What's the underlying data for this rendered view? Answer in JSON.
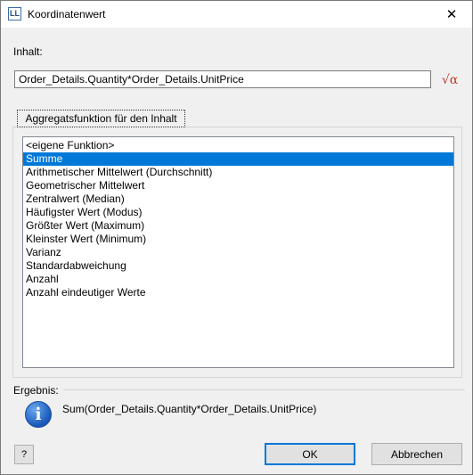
{
  "window": {
    "title": "Koordinatenwert",
    "app_icon_text": "LL",
    "close_glyph": "✕"
  },
  "content": {
    "label": "Inhalt:",
    "value": "Order_Details.Quantity*Order_Details.UnitPrice",
    "formula_icon": "√α"
  },
  "aggregate": {
    "tab_label": "Aggregatsfunktion für den Inhalt",
    "items": [
      "<eigene Funktion>",
      "Summe",
      "Arithmetischer Mittelwert (Durchschnitt)",
      "Geometrischer Mittelwert",
      "Zentralwert (Median)",
      "Häufigster Wert (Modus)",
      "Größter Wert (Maximum)",
      "Kleinster Wert (Minimum)",
      "Varianz",
      "Standardabweichung",
      "Anzahl",
      "Anzahl eindeutiger Werte"
    ],
    "selected_index": 1
  },
  "result": {
    "label": "Ergebnis:",
    "info_glyph": "i",
    "text": "Sum(Order_Details.Quantity*Order_Details.UnitPrice)"
  },
  "buttons": {
    "help_glyph": "?",
    "ok_label": "OK",
    "cancel_label": "Abbrechen"
  },
  "colors": {
    "selection": "#0078d7",
    "default_button_border": "#0078d7"
  }
}
